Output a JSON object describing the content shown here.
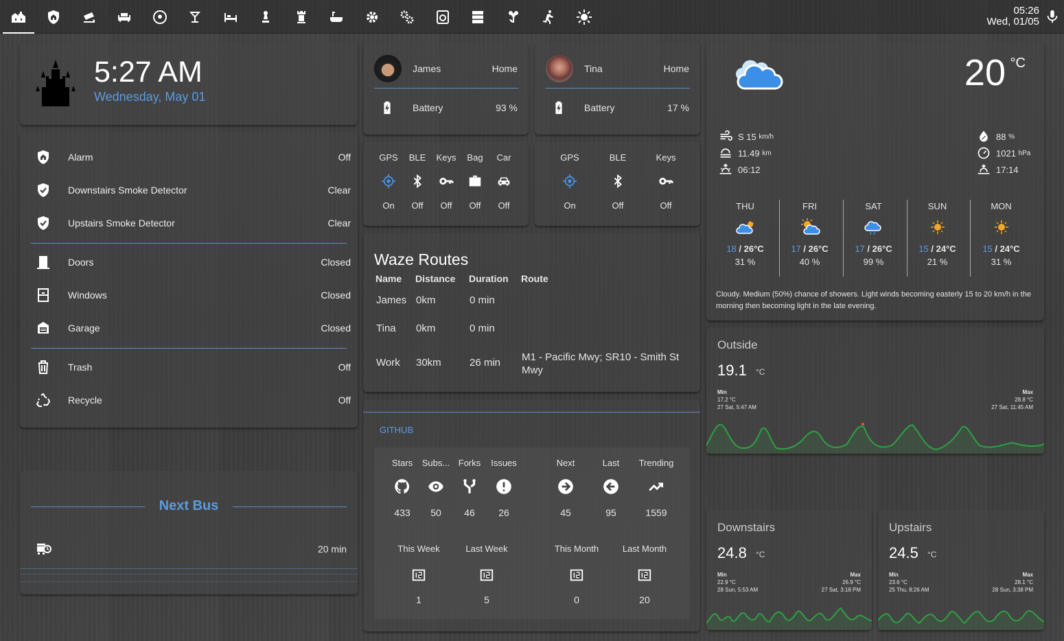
{
  "topbar": {
    "tabs": [
      {
        "icon": "home-city-icon"
      },
      {
        "icon": "shield-home-icon"
      },
      {
        "icon": "cctv-icon"
      },
      {
        "icon": "sofa-icon"
      },
      {
        "icon": "soccer-ball-icon"
      },
      {
        "icon": "glass-cocktail-icon"
      },
      {
        "icon": "bed-icon"
      },
      {
        "icon": "chess-pawn-icon"
      },
      {
        "icon": "chess-rook-icon"
      },
      {
        "icon": "bathtub-icon"
      },
      {
        "icon": "settings-icon"
      },
      {
        "icon": "settings-multiple-icon"
      },
      {
        "icon": "washing-machine-icon"
      },
      {
        "icon": "server-icon"
      },
      {
        "icon": "flower-icon"
      },
      {
        "icon": "run-icon"
      },
      {
        "icon": "weather-sunny-icon"
      }
    ],
    "time": "05:26",
    "date": "Wed, 01/05"
  },
  "clock": {
    "time": "5:27 AM",
    "date": "Wednesday, May 01"
  },
  "security": {
    "items": [
      {
        "label": "Alarm",
        "value": "Off"
      },
      {
        "label": "Downstairs Smoke Detector",
        "value": "Clear"
      },
      {
        "label": "Upstairs Smoke Detector",
        "value": "Clear"
      },
      {
        "label": "Doors",
        "value": "Closed"
      },
      {
        "label": "Windows",
        "value": "Closed"
      },
      {
        "label": "Garage",
        "value": "Closed"
      },
      {
        "label": "Trash",
        "value": "Off"
      },
      {
        "label": "Recycle",
        "value": "Off"
      }
    ]
  },
  "bus": {
    "title": "Next Bus",
    "value": "20 min"
  },
  "people": [
    {
      "name": "James",
      "state": "Home",
      "battery_label": "Battery",
      "battery": "93 %"
    },
    {
      "name": "Tina",
      "state": "Home",
      "battery_label": "Battery",
      "battery": "17 %"
    }
  ],
  "trackers": [
    {
      "cols": [
        {
          "label": "GPS",
          "state": "On"
        },
        {
          "label": "BLE",
          "state": "Off"
        },
        {
          "label": "Keys",
          "state": "Off"
        },
        {
          "label": "Bag",
          "state": "Off"
        },
        {
          "label": "Car",
          "state": "Off"
        }
      ]
    },
    {
      "cols": [
        {
          "label": "GPS",
          "state": "On"
        },
        {
          "label": "BLE",
          "state": "Off"
        },
        {
          "label": "Keys",
          "state": "Off"
        }
      ]
    }
  ],
  "waze": {
    "title": "Waze Routes",
    "headers": [
      "Name",
      "Distance",
      "Duration",
      "Route"
    ],
    "rows": [
      [
        "James",
        "0km",
        "0 min",
        ""
      ],
      [
        "Tina",
        "0km",
        "0 min",
        ""
      ],
      [
        "Work",
        "30km",
        "26 min",
        "M1 - Pacific Mwy; SR10 - Smith St Mwy"
      ]
    ]
  },
  "github": {
    "title": "GITHUB",
    "stats": [
      {
        "label": "Stars",
        "value": "433",
        "icon": "github-icon"
      },
      {
        "label": "Subs...",
        "value": "50",
        "icon": "eye-icon"
      },
      {
        "label": "Forks",
        "value": "46",
        "icon": "fork-icon"
      },
      {
        "label": "Issues",
        "value": "26",
        "icon": "alert-circle-icon"
      },
      {
        "label": "Next",
        "value": "45",
        "icon": "arrow-right-circle-icon"
      },
      {
        "label": "Last",
        "value": "95",
        "icon": "arrow-left-circle-icon"
      },
      {
        "label": "Trending",
        "value": "1559",
        "icon": "trending-up-icon"
      }
    ],
    "periods": [
      {
        "label": "This Week",
        "value": "1"
      },
      {
        "label": "Last Week",
        "value": "5"
      },
      {
        "label": "This Month",
        "value": "0"
      },
      {
        "label": "Last Month",
        "value": "20"
      }
    ]
  },
  "weather": {
    "temp": "20",
    "unit": "°C",
    "wind": "S 15",
    "wind_unit": "km/h",
    "visibility": "11.49",
    "visibility_unit": "km",
    "sunrise": "06:12",
    "humidity": "88",
    "humidity_unit": "%",
    "pressure": "1021",
    "pressure_unit": "hPa",
    "sunset": "17:14",
    "forecast": [
      {
        "day": "THU",
        "low": "18",
        "high": "/ 26°C",
        "rain": "31 %",
        "icon": "partly-cloudy-night-icon"
      },
      {
        "day": "FRI",
        "low": "17",
        "high": "/ 26°C",
        "rain": "40 %",
        "icon": "partly-sunny-icon"
      },
      {
        "day": "SAT",
        "low": "17",
        "high": "/ 26°C",
        "rain": "99 %",
        "icon": "rain-cloud-icon"
      },
      {
        "day": "SUN",
        "low": "15",
        "high": "/ 24°C",
        "rain": "21 %",
        "icon": "sun-icon"
      },
      {
        "day": "MON",
        "low": "15",
        "high": "/ 24°C",
        "rain": "31 %",
        "icon": "sun-icon"
      }
    ],
    "summary": "Cloudy. Medium (50%) chance of showers. Light winds becoming easterly 15 to 20 km/h in the morning then becoming light in the late evening."
  },
  "sensors": {
    "outside": {
      "title": "Outside",
      "value": "19.1",
      "unit": "°C",
      "min_label": "Min",
      "min": "17.2 °C",
      "min_time": "27 Sat, 5:47 AM",
      "max_label": "Max",
      "max": "28.8 °C",
      "max_time": "27 Sat, 11:45 AM"
    },
    "downstairs": {
      "title": "Downstairs",
      "value": "24.8",
      "unit": "°C",
      "min_label": "Min",
      "min": "22.9 °C",
      "min_time": "28 Sun, 5:53 AM",
      "max_label": "Max",
      "max": "26.9 °C",
      "max_time": "27 Sat, 3:18 PM"
    },
    "upstairs": {
      "title": "Upstairs",
      "value": "24.5",
      "unit": "°C",
      "min_label": "Min",
      "min": "23.6 °C",
      "min_time": "25 Thu, 8:26 AM",
      "max_label": "Max",
      "max": "28.1 °C",
      "max_time": "28 Sun, 3:38 PM"
    }
  },
  "colors": {
    "accent": "#5b9be0",
    "graph": "#2ea043"
  }
}
